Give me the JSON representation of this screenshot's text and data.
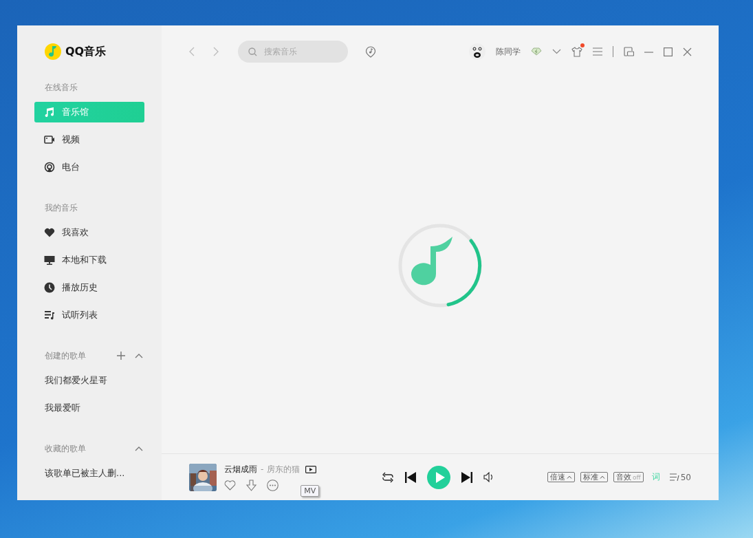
{
  "app": {
    "name": "QQ音乐"
  },
  "sidebar": {
    "sections": [
      {
        "title": "在线音乐",
        "items": [
          {
            "label": "音乐馆",
            "selected": true
          },
          {
            "label": "视频",
            "selected": false
          },
          {
            "label": "电台",
            "selected": false
          }
        ]
      },
      {
        "title": "我的音乐",
        "items": [
          {
            "label": "我喜欢",
            "selected": false
          },
          {
            "label": "本地和下载",
            "selected": false
          },
          {
            "label": "播放历史",
            "selected": false
          },
          {
            "label": "试听列表",
            "selected": false
          }
        ]
      },
      {
        "title": "创建的歌单",
        "can_add": true,
        "collapsible": true,
        "items": [
          {
            "label": "我们都爱火星哥",
            "selected": false
          },
          {
            "label": "我最爱听",
            "selected": false
          }
        ]
      },
      {
        "title": "收藏的歌单",
        "collapsible": true,
        "items": [
          {
            "label": "该歌单已被主人删...",
            "selected": false
          }
        ]
      }
    ]
  },
  "topbar": {
    "search": {
      "placeholder": "搜索音乐"
    },
    "user": {
      "name": "陈同学"
    },
    "skin_notification": true
  },
  "player": {
    "song": {
      "title": "云烟成雨",
      "separator": "-",
      "artist": "房东的猫"
    },
    "tooltip": "MV",
    "options": [
      {
        "label": "倍速",
        "kind": "dropdown"
      },
      {
        "label": "标准",
        "kind": "dropdown"
      },
      {
        "label": "音效",
        "kind": "toggle",
        "state": "off"
      }
    ],
    "lyrics": "词",
    "playlist_count": "50"
  }
}
